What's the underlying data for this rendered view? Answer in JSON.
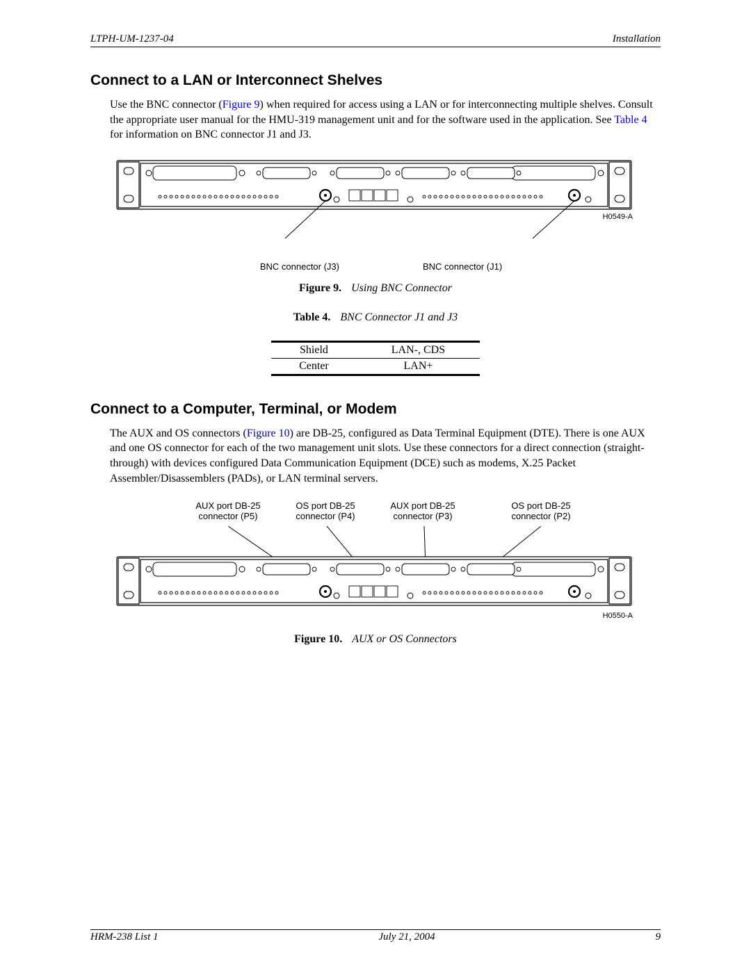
{
  "header": {
    "left": "LTPH-UM-1237-04",
    "right": "Installation"
  },
  "footer": {
    "left": "HRM-238 List 1",
    "center": "July 21, 2004",
    "right": "9"
  },
  "section1": {
    "heading": "Connect to a LAN or Interconnect Shelves",
    "para_pre": "Use the BNC connector (",
    "para_link": "Figure 9",
    "para_mid": ") when required for access using a LAN or for interconnecting multiple shelves. Consult the appropriate user manual for the HMU-319 management unit and for the software used in the application. See ",
    "para_link2": "Table 4",
    "para_post": " for information on BNC connector J1 and J3."
  },
  "figure9": {
    "annot_left": "BNC connector (J3)",
    "annot_right": "BNC connector (J1)",
    "partno": "H0549-A",
    "caption_label": "Figure 9.",
    "caption_text": "Using BNC Connector"
  },
  "table4": {
    "caption_label": "Table 4.",
    "caption_text": "BNC Connector J1 and J3",
    "rows": [
      {
        "a": "Shield",
        "b": "LAN-, CDS"
      },
      {
        "a": "Center",
        "b": "LAN+"
      }
    ]
  },
  "section2": {
    "heading": "Connect to a Computer, Terminal, or Modem",
    "para_pre": "The AUX and OS connectors (",
    "para_link": "Figure 10",
    "para_post": ") are DB-25, configured as Data Terminal Equipment (DTE). There is one AUX and one OS connector for each of the two management unit slots. Use these connectors for a direct connection (straight-through) with devices configured Data Communication Equipment (DCE) such as modems, X.25 Packet Assembler/Disassemblers (PADs), or LAN terminal servers."
  },
  "figure10": {
    "annots": [
      "AUX port DB-25\nconnector (P5)",
      "OS port DB-25\nconnector (P4)",
      "AUX port DB-25\nconnector (P3)",
      "OS port DB-25\nconnector (P2)"
    ],
    "partno": "H0550-A",
    "caption_label": "Figure 10.",
    "caption_text": "AUX or OS Connectors"
  }
}
